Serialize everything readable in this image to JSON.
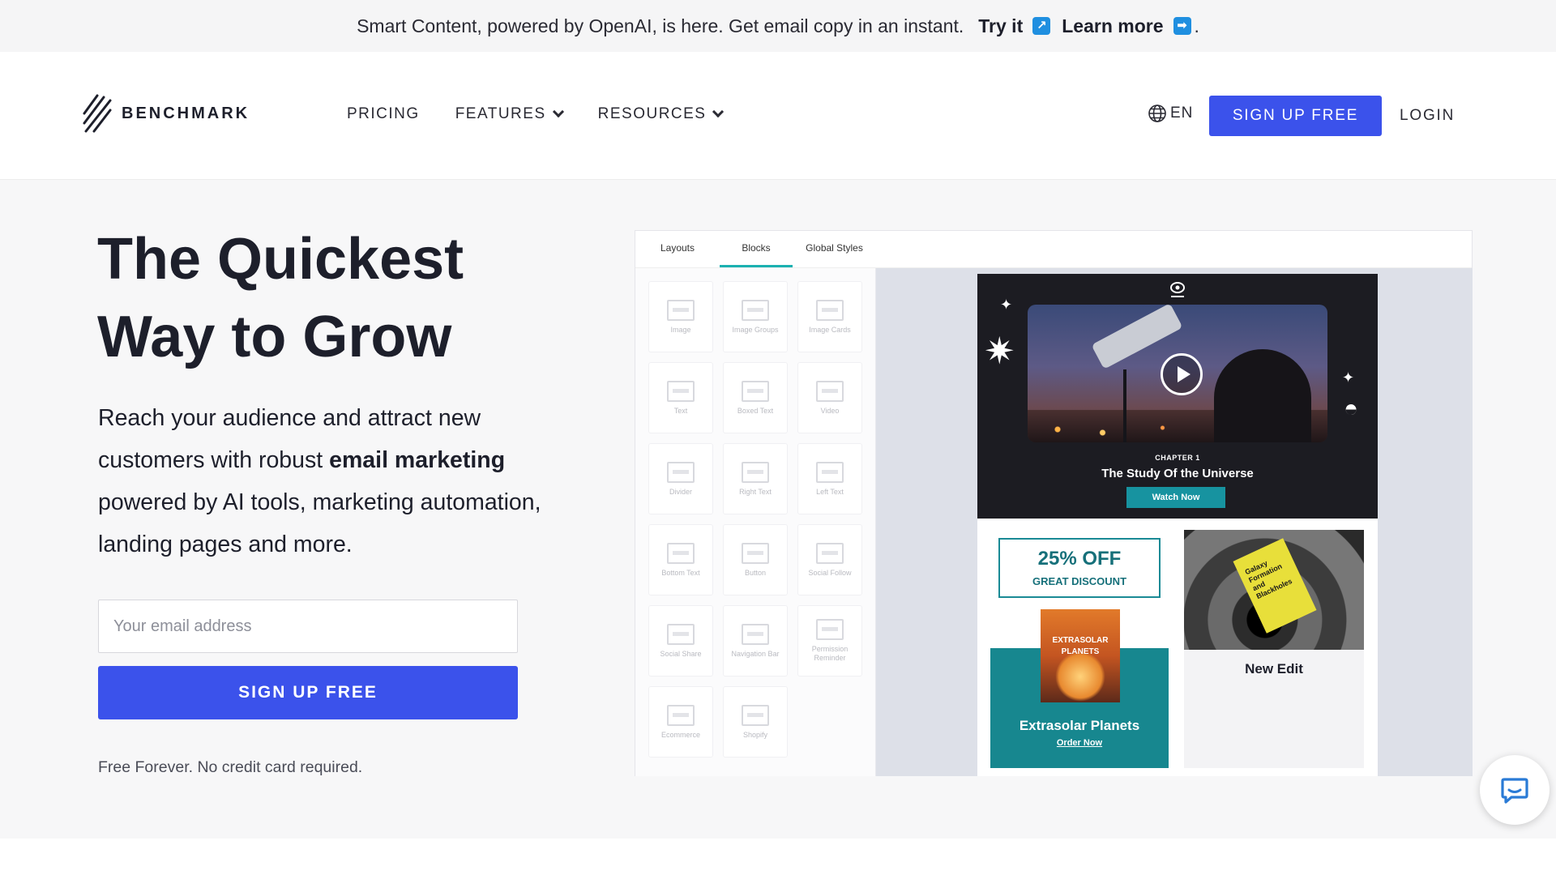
{
  "announcement": {
    "message": "Smart Content, powered by OpenAI, is here. Get email copy in an instant.",
    "try_it": "Try it",
    "learn_more": "Learn more",
    "period": "."
  },
  "nav": {
    "logo_text": "BENCHMARK",
    "links": [
      "PRICING",
      "FEATURES",
      "RESOURCES"
    ],
    "language": "EN",
    "signup": "SIGN UP FREE",
    "login": "LOGIN"
  },
  "hero": {
    "title_line1": "The Quickest",
    "title_line2": "Way to Grow",
    "desc_part1": "Reach your audience and attract new customers with robust ",
    "desc_bold": "email marketing",
    "desc_part2": " powered by AI tools, marketing automation, landing pages and more.",
    "email_placeholder": "Your email address",
    "signup": "SIGN UP FREE",
    "note": "Free Forever. No credit card required."
  },
  "editor": {
    "tabs": [
      "Layouts",
      "Blocks",
      "Global Styles"
    ],
    "active_tab": "Blocks",
    "blocks": [
      "Image",
      "Image Groups",
      "Image Cards",
      "Text",
      "Boxed Text",
      "Video",
      "Divider",
      "Right Text",
      "Left Text",
      "Bottom Text",
      "Button",
      "Social Follow",
      "Social Share",
      "Navigation Bar",
      "Permission Reminder",
      "Ecommerce",
      "Shopify"
    ],
    "email": {
      "chapter": "CHAPTER 1",
      "video_title": "The Study Of the Universe",
      "watch_button": "Watch Now",
      "discount_big": "25% OFF",
      "discount_small": "GREAT DISCOUNT",
      "planet_card_text": "EXTRASOLAR PLANETS",
      "planet_title": "Extrasolar Planets",
      "order_link": "Order Now",
      "book_text": "Galaxy Formation and Blackholes",
      "new_edit": "New Edit"
    }
  },
  "colors": {
    "primary": "#3b52eb",
    "teal": "#17878f",
    "announce_icon": "#1f8fe0"
  }
}
